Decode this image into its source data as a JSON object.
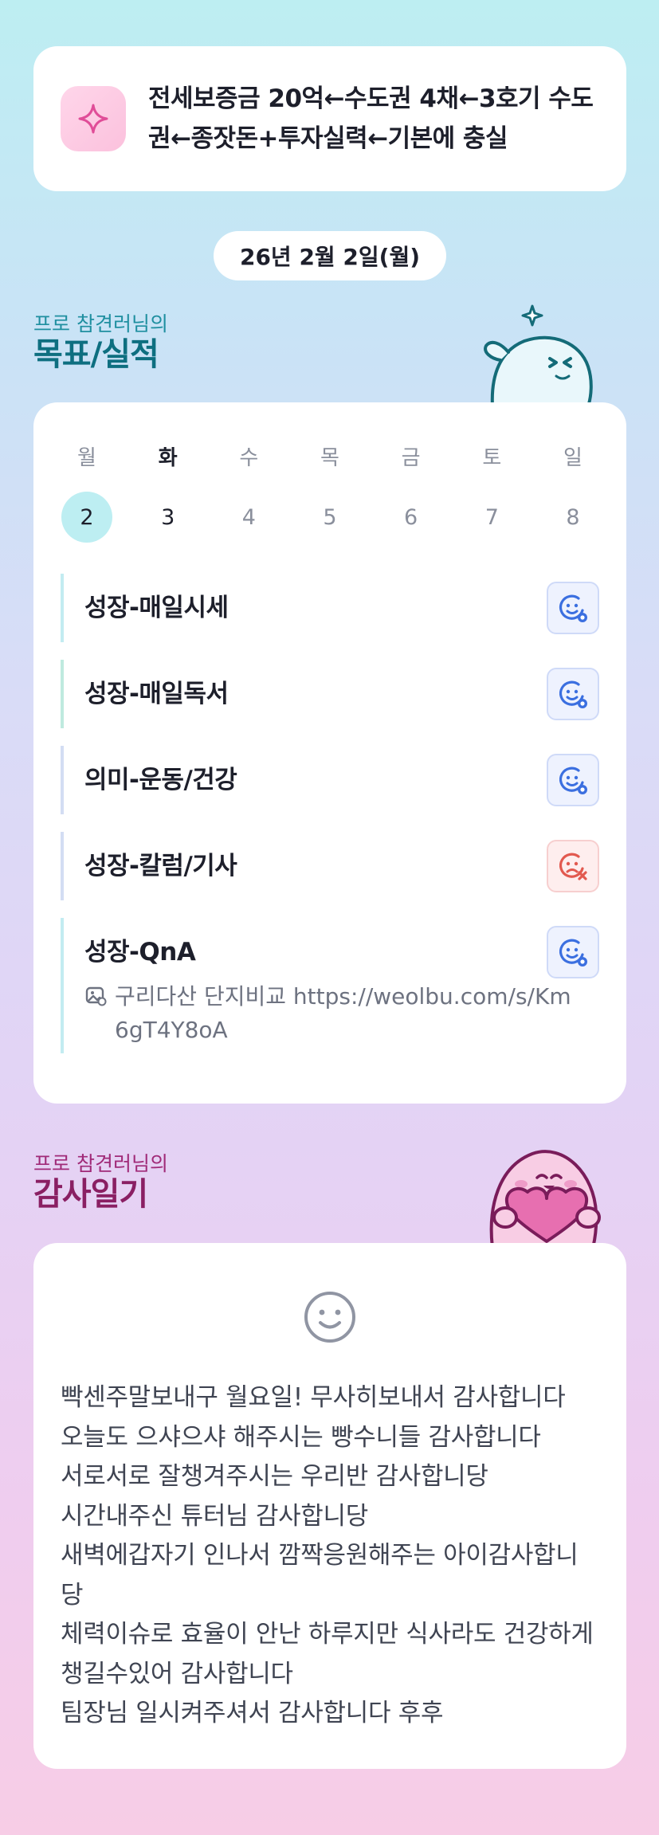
{
  "goal": {
    "icon": "sparkle-icon",
    "text": "전세보증금 20억←수도권 4채←3호기 수도권←종잣돈+투자실력←기본에 충실"
  },
  "date_label": "26년 2월 2일(월)",
  "goals_section": {
    "subtitle": "프로 참견러님의",
    "title": "목표/실적"
  },
  "week": [
    {
      "day": "월",
      "num": "2"
    },
    {
      "day": "화",
      "num": "3"
    },
    {
      "day": "수",
      "num": "4"
    },
    {
      "day": "목",
      "num": "5"
    },
    {
      "day": "금",
      "num": "6"
    },
    {
      "day": "토",
      "num": "7"
    },
    {
      "day": "일",
      "num": "8"
    }
  ],
  "habits": [
    {
      "label": "성장-매일시세",
      "status": "done"
    },
    {
      "label": "성장-매일독서",
      "status": "done"
    },
    {
      "label": "의미-운동/건강",
      "status": "done"
    },
    {
      "label": "성장-칼럼/기사",
      "status": "failed"
    },
    {
      "label": "성장-QnA",
      "status": "done",
      "note": "구리다산 단지비교 https://weolbu.com/s/Km6gT4Y8oA"
    }
  ],
  "thanks_section": {
    "subtitle": "프로 참견러님의",
    "title": "감사일기"
  },
  "thanks_lines": [
    "빡센주말보내구 월요일! 무사히보내서 감사합니다",
    "오늘도 으샤으샤 해주시는 빵수니들 감사합니다",
    "서로서로 잘챙겨주시는 우리반 감사합니당",
    "시간내주신 튜터님 감사합니당",
    "새벽에갑자기 인나서 깜짝응원해주는 아이감사합니당",
    "체력이슈로 효율이 안난 하루지만 식사라도 건강하게챙길수있어 감사합니다",
    "팀장님 일시켜주셔서 감사합니다 후후"
  ],
  "colors": {
    "accent_teal": "#0e6f80",
    "accent_purple": "#8a1f63",
    "selected_day": "#bdeef2",
    "status_ok": "#3b6fe0",
    "status_fail": "#e2594f"
  }
}
